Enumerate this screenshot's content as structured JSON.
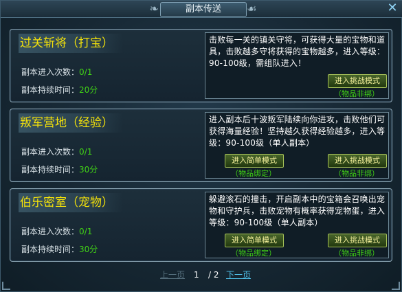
{
  "window": {
    "title": "副本传送",
    "close_icon": "close-icon"
  },
  "dungeons": [
    {
      "name": "过关斩将（打宝）",
      "entries_label": "副本进入次数：",
      "entries_value": "0/1",
      "duration_label": "副本持续时间：",
      "duration_value": "20分",
      "description": "击败每一关的镇关守将，可获得大量的宝物和道具，击败越多守将获得的宝物越多，进入等级：90-100级，需组队进入！",
      "buttons": [
        {
          "label": "进入挑战模式",
          "tag": "（物品非绑）"
        }
      ]
    },
    {
      "name": "叛军营地（经验）",
      "entries_label": "副本进入次数：",
      "entries_value": "0/1",
      "duration_label": "副本持续时间：",
      "duration_value": "30分",
      "description": "进入副本后十波叛军陆续向你进攻，击败他们可获得海量经验！坚持越久获得经验越多，进入等级：90-100级（单人副本）",
      "buttons": [
        {
          "label": "进入简单模式",
          "tag": "（物品绑定）"
        },
        {
          "label": "进入挑战模式",
          "tag": "（物品非绑）"
        }
      ]
    },
    {
      "name": "伯乐密室（宠物）",
      "entries_label": "副本进入次数：",
      "entries_value": "0/1",
      "duration_label": "副本持续时间：",
      "duration_value": "30分",
      "description": "躲避滚石的撞击，开启副本中的宝箱会召唤出宠物和守护兵，击败宠物有概率获得宠物蛋，进入等级：90-100级（单人副本）",
      "buttons": [
        {
          "label": "进入简单模式",
          "tag": "（物品绑定）"
        },
        {
          "label": "进入挑战模式",
          "tag": "（物品非绑）"
        }
      ]
    }
  ],
  "pager": {
    "prev": "上一页",
    "current": "1",
    "total": "/ 2",
    "next": "下一页"
  },
  "colors": {
    "name": "#f4e20a",
    "value_green": "#41d316",
    "link_blue": "#4fbfe8"
  }
}
